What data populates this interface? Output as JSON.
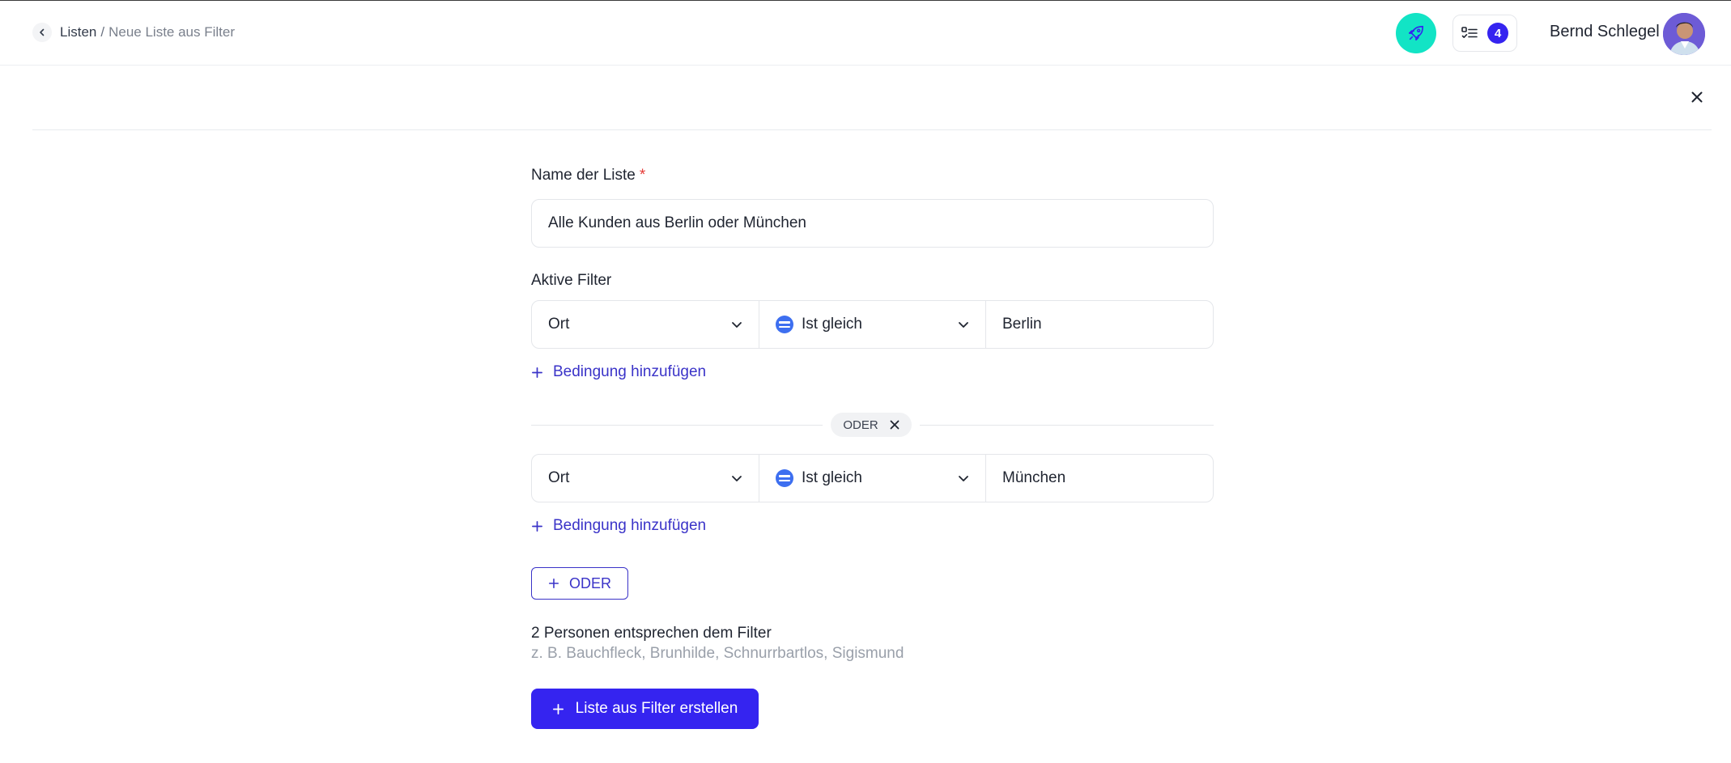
{
  "header": {
    "breadcrumb": {
      "root": "Listen",
      "separator": "/",
      "current": "Neue Liste aus Filter"
    },
    "tasks_count": "4",
    "user_name": "Bernd Schlegel"
  },
  "form": {
    "name_label": "Name der Liste",
    "required_mark": "*",
    "name_value": "Alle Kunden aus Berlin oder München",
    "filters_label": "Aktive Filter",
    "groups": [
      {
        "field": "Ort",
        "operator": "Ist gleich",
        "value": "Berlin",
        "add_condition_label": "Bedingung hinzufügen"
      },
      {
        "field": "Ort",
        "operator": "Ist gleich",
        "value": "München",
        "add_condition_label": "Bedingung hinzufügen"
      }
    ],
    "or_separator_label": "ODER",
    "add_or_label": "ODER",
    "match_count_text": "2 Personen entsprechen dem Filter",
    "match_examples_text": "z. B. Bauchfleck, Brunhilde, Schnurrbartlos, Sigismund",
    "submit_label": "Liste aus Filter erstellen"
  },
  "colors": {
    "primary": "#3524f0",
    "link": "#3a33c8",
    "rocket": "#12e4c5",
    "operator_icon": "#3d6ff0",
    "required": "#e53935"
  },
  "icons": {
    "back": "chevron-left-icon",
    "rocket": "rocket-icon",
    "tasks": "checklist-icon",
    "close": "close-icon",
    "dropdown": "chevron-down-icon",
    "operator": "equals-icon",
    "add": "plus-icon",
    "remove": "x-icon"
  }
}
